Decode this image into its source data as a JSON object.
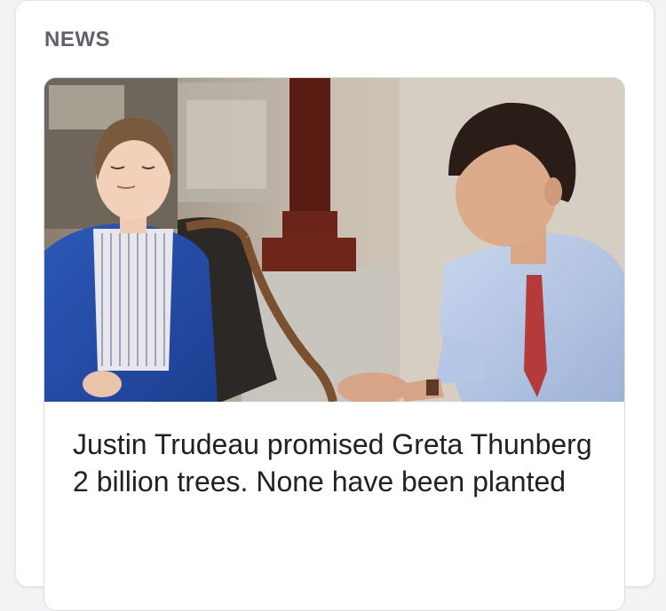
{
  "section": {
    "label": "NEWS"
  },
  "article": {
    "headline": "Justin Trudeau promised Greta Thunberg 2 billion trees. None have been planted",
    "image_icon": "news-photo"
  },
  "colors": {
    "page_background": "#f1f3f4",
    "card_background": "#ffffff",
    "label_color": "#5f6368",
    "headline_color": "#202124"
  }
}
